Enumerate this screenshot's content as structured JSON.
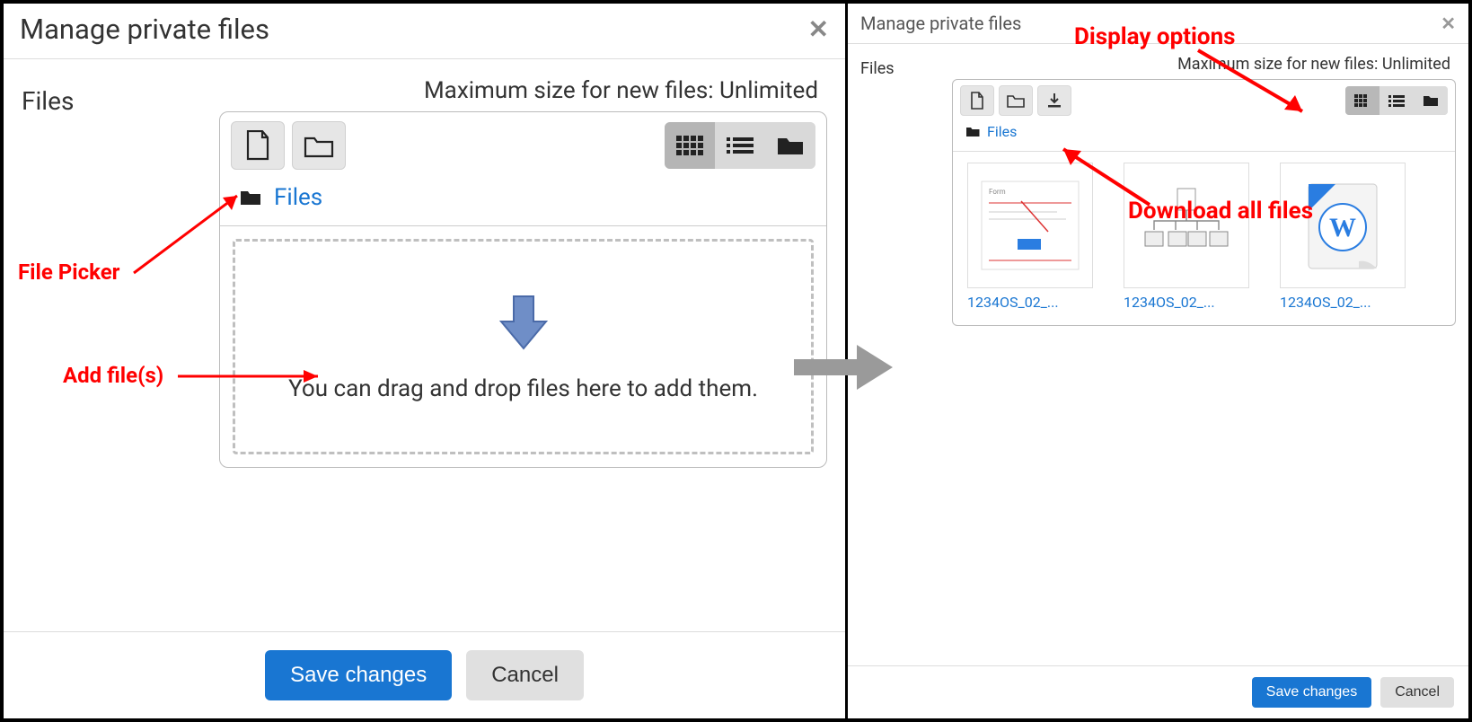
{
  "left": {
    "title": "Manage private files",
    "files_label": "Files",
    "max_size": "Maximum size for new files: Unlimited",
    "breadcrumb": "Files",
    "drop_text": "You can drag and drop files here to add them.",
    "save": "Save changes",
    "cancel": "Cancel"
  },
  "right": {
    "title": "Manage private files",
    "files_label": "Files",
    "max_size": "Maximum size for new files: Unlimited",
    "breadcrumb": "Files",
    "files": [
      {
        "name": "1234OS_02_..."
      },
      {
        "name": "1234OS_02_..."
      },
      {
        "name": "1234OS_02_..."
      }
    ],
    "save": "Save changes",
    "cancel": "Cancel"
  },
  "annotations": {
    "file_picker": "File Picker",
    "add_files": "Add file(s)",
    "display_options": "Display options",
    "download_all": "Download all files"
  }
}
